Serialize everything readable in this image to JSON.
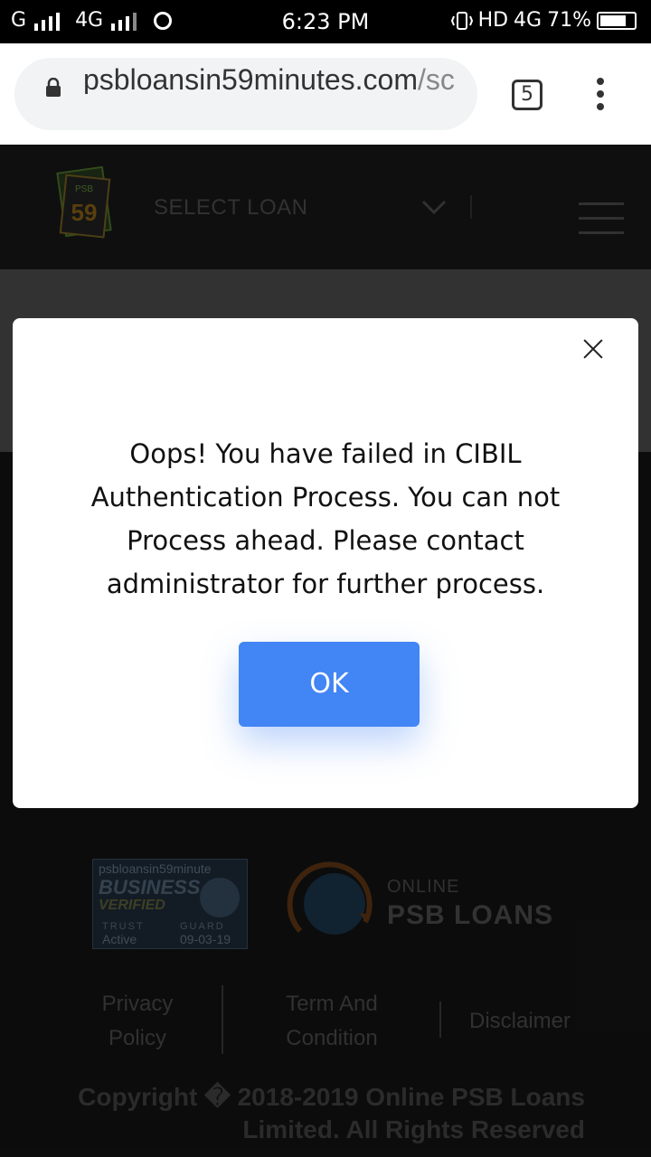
{
  "status_bar": {
    "left": "G",
    "net": "4G",
    "time": "6:23 PM",
    "hd": "HD",
    "net2": "4G",
    "battery": "71%"
  },
  "browser": {
    "url_main": "psbloansin59minutes.com",
    "url_rest": "/sc",
    "tab_count": "5"
  },
  "header": {
    "logo_top": "PSB",
    "logo_num": "59",
    "select_loan": "SELECT LOAN"
  },
  "modal": {
    "message": "Oops! You have failed in CIBIL Authentication Process. You can not Process ahead. Please contact administrator for further process.",
    "ok_label": "OK"
  },
  "footer": {
    "badge_site": "psbloansin59minute",
    "badge_business": "BUSINESS",
    "badge_verified": "VERIFIED",
    "badge_trust": "TRUST",
    "badge_guard": "GUARD",
    "badge_active": "Active",
    "badge_date": "09-03-19",
    "online": "ONLINE",
    "psb_loans": "PSB LOANS",
    "privacy_1": "Privacy",
    "privacy_2": "Policy",
    "term_1": "Term And",
    "term_2": "Condition",
    "disclaimer": "Disclaimer",
    "copyright": "Copyright � 2018-2019 Online PSB Loans Limited. All Rights Reserved"
  }
}
